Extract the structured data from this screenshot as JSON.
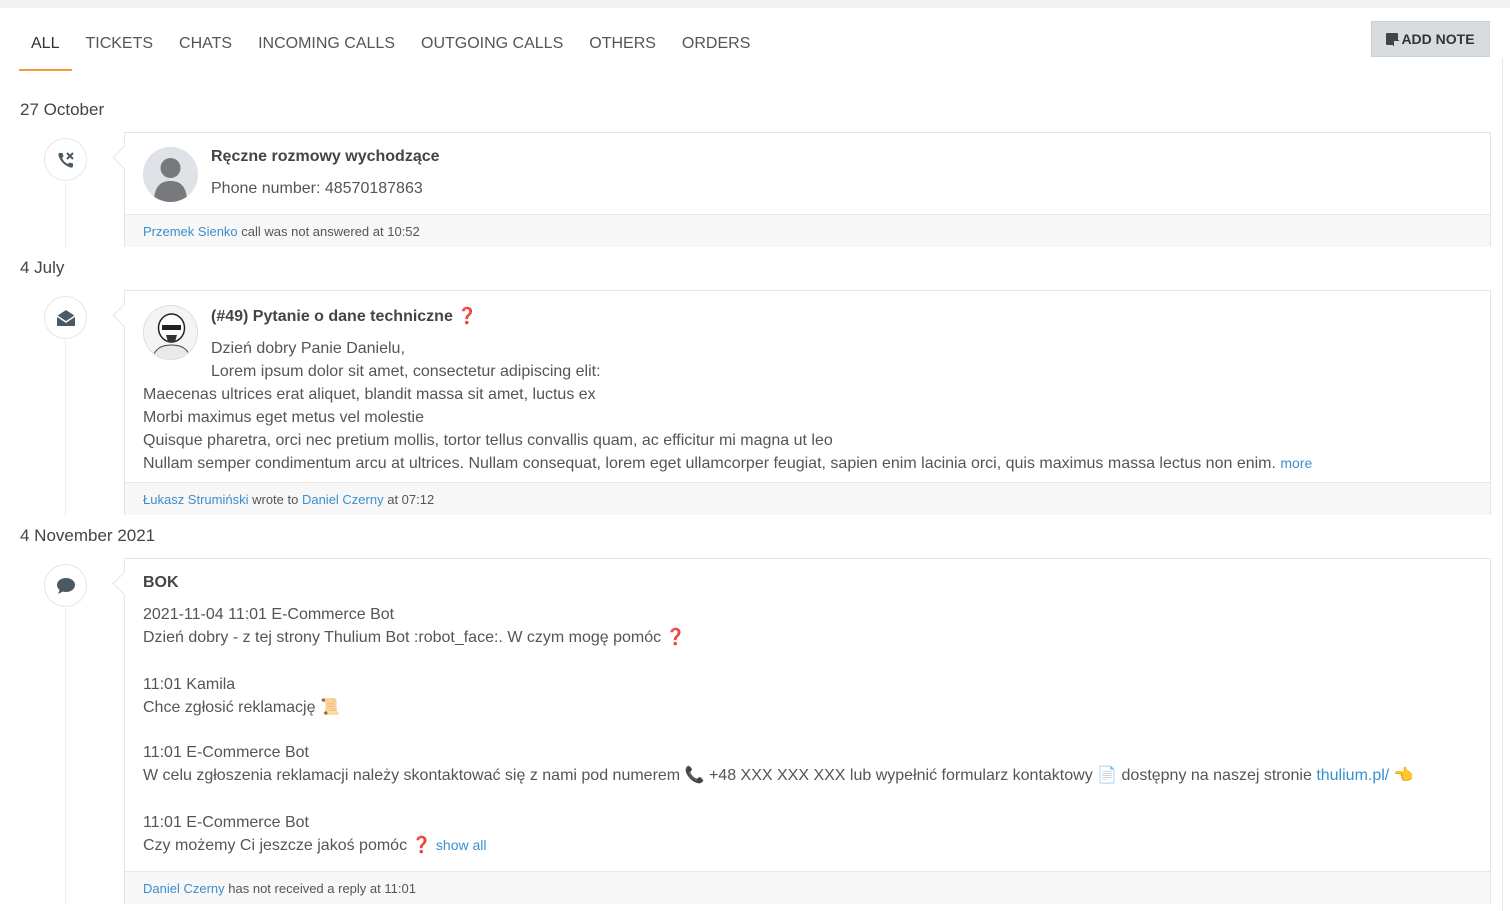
{
  "tabs": [
    {
      "label": "ALL",
      "active": true
    },
    {
      "label": "TICKETS"
    },
    {
      "label": "CHATS"
    },
    {
      "label": "INCOMING CALLS"
    },
    {
      "label": "OUTGOING CALLS"
    },
    {
      "label": "OTHERS"
    },
    {
      "label": "ORDERS"
    }
  ],
  "add_note_label": "ADD NOTE",
  "entries": [
    {
      "date": "27 October",
      "icon": "missed-call-icon",
      "title": "Ręczne rozmowy wychodzące",
      "phone_line": "Phone number: 48570187863",
      "footer": {
        "user": "Przemek Sienko",
        "text": " call was not answered at 10:52"
      }
    },
    {
      "date": "4 July",
      "icon": "open-envelope-icon",
      "title": "(#49) Pytanie o dane techniczne",
      "title_mark": "❓",
      "lines": [
        "Dzień dobry Panie Danielu,",
        "Lorem ipsum dolor sit amet, consectetur adipiscing elit:",
        "Maecenas ultrices erat aliquet, blandit massa sit amet, luctus ex",
        "Morbi maximus eget metus vel molestie",
        "Quisque pharetra, orci nec pretium mollis, tortor tellus convallis quam, ac efficitur mi magna ut leo",
        "Nullam semper condimentum arcu at ultrices. Nullam consequat, lorem eget ullamcorper feugiat, sapien enim lacinia orci, quis maximus massa lectus non enim."
      ],
      "more_label": "more",
      "footer": {
        "user": "Łukasz Strumiński",
        "mid": " wrote to ",
        "user2": "Daniel Czerny",
        "text": " at 07:12"
      }
    },
    {
      "date": "4 November 2021",
      "icon": "chat-bubble-icon",
      "title": "BOK",
      "messages": [
        {
          "header": "2021-11-04 11:01 E-Commerce Bot",
          "text": "Dzień dobry - z tej strony Thulium Bot :robot_face:. W czym mogę pomóc",
          "emoji": "❓"
        },
        {
          "header": "11:01 Kamila",
          "text": "Chce zgłosić reklamację",
          "emoji": "📜"
        },
        {
          "header": "11:01 E-Commerce Bot",
          "text_a": "W celu zgłoszenia reklamacji należy skontaktować się z nami pod numerem",
          "emoji_a": "📞",
          "text_b": "+48 XXX XXX XXX lub wypełnić formularz kontaktowy",
          "emoji_b": "📄",
          "text_c": "dostępny na naszej stronie",
          "link": "thulium.pl/",
          "emoji_c": "👈"
        },
        {
          "header": "11:01 E-Commerce Bot",
          "text": "Czy możemy Ci jeszcze jakoś pomóc",
          "emoji": "❓",
          "show_all": "show all"
        }
      ],
      "footer": {
        "user": "Daniel Czerny",
        "text": " has not received a reply at 11:01"
      }
    }
  ]
}
